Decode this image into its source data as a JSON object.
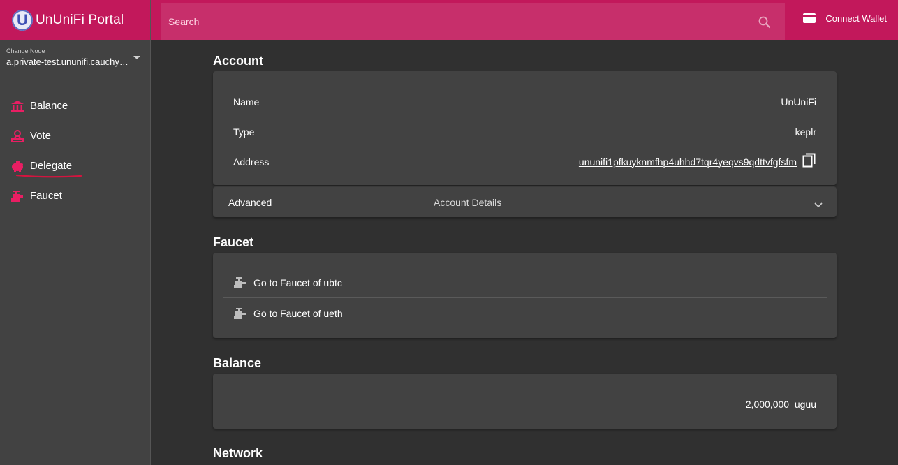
{
  "app": {
    "logo_letter": "U",
    "title": "UnUniFi Portal"
  },
  "colors": {
    "brand": "#c2185b",
    "sidebar": "#424242",
    "background": "#303030",
    "card": "#424242"
  },
  "node": {
    "label": "Change Node",
    "value": "a.private-test.ununifi.cauchye.net"
  },
  "nav": [
    {
      "label": "Balance",
      "icon": "bank-icon"
    },
    {
      "label": "Vote",
      "icon": "vote-icon"
    },
    {
      "label": "Delegate",
      "icon": "piggy-bank-icon"
    },
    {
      "label": "Faucet",
      "icon": "faucet-icon"
    }
  ],
  "search": {
    "placeholder": "Search"
  },
  "wallet": {
    "label": "Connect Wallet"
  },
  "account": {
    "title": "Account",
    "name_label": "Name",
    "name_value": "UnUniFi",
    "type_label": "Type",
    "type_value": "keplr",
    "address_label": "Address",
    "address_value": "ununifi1pfkuyknmfhp4uhhd7tqr4yeqvs9qdttvfgfsfm",
    "advanced_label": "Advanced",
    "advanced_desc": "Account Details"
  },
  "faucet": {
    "title": "Faucet",
    "items": [
      "Go to Faucet of ubtc",
      "Go to Faucet of ueth"
    ]
  },
  "balance": {
    "title": "Balance",
    "amount": "2,000,000",
    "denom": "uguu"
  },
  "network": {
    "title": "Network"
  }
}
